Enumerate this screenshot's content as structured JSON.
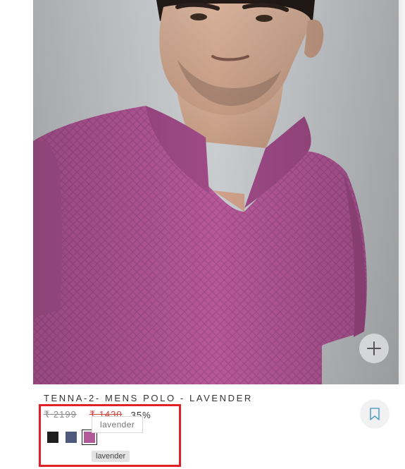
{
  "product": {
    "title": "TENNA-2- MENS POLO - LAVENDER",
    "mrp": "₹ 2199",
    "sale_price": "₹ 1430",
    "discount": "35%"
  },
  "image": {
    "subject": "Model wearing a lavender textured polo shirt"
  },
  "swatches": [
    {
      "name": "black",
      "color": "#1f1f1f",
      "selected": false
    },
    {
      "name": "navy",
      "color": "#4e5a7c",
      "selected": false
    },
    {
      "name": "lavender",
      "color": "#b25a97",
      "selected": true
    }
  ],
  "tooltip": {
    "hover_label": "lavender",
    "selected_label": "lavender"
  },
  "colors": {
    "accent_red": "#e2202a",
    "sale_red": "#d0413c",
    "shirt": "#b6589a"
  },
  "icons": {
    "zoom": "plus-icon",
    "wishlist": "bookmark-icon"
  }
}
